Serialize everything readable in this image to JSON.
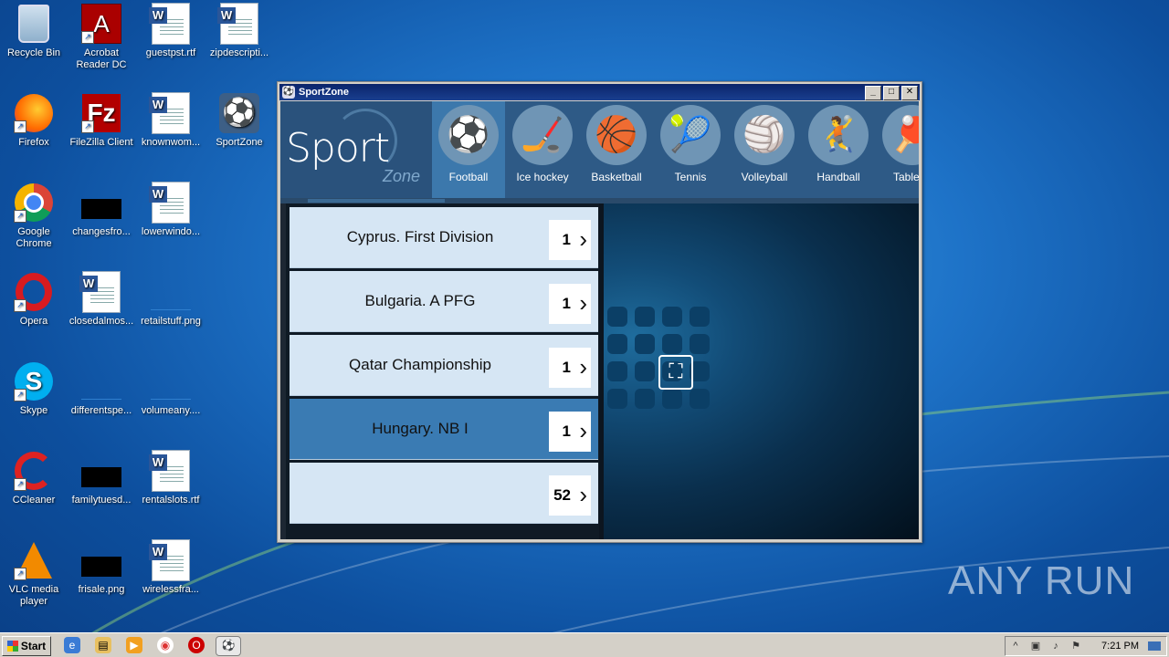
{
  "desktop": {
    "icons": [
      {
        "label": "Recycle Bin",
        "icon": "recycle-bin-icon"
      },
      {
        "label": "Acrobat Reader DC",
        "icon": "acrobat-icon"
      },
      {
        "label": "guestpst.rtf",
        "icon": "word-doc-icon"
      },
      {
        "label": "zipdescripti...",
        "icon": "word-doc-icon"
      },
      {
        "label": "Firefox",
        "icon": "firefox-icon"
      },
      {
        "label": "FileZilla Client",
        "icon": "filezilla-icon"
      },
      {
        "label": "knownwom...",
        "icon": "word-doc-icon"
      },
      {
        "label": "SportZone",
        "icon": "sportzone-icon"
      },
      {
        "label": "Google Chrome",
        "icon": "chrome-icon"
      },
      {
        "label": "changesfro...",
        "icon": "image-file-icon"
      },
      {
        "label": "lowerwindo...",
        "icon": "word-doc-icon"
      },
      {
        "label": "Opera",
        "icon": "opera-icon"
      },
      {
        "label": "closedalmos...",
        "icon": "word-doc-icon"
      },
      {
        "label": "retailstuff.png",
        "icon": "image-file-icon"
      },
      {
        "label": "Skype",
        "icon": "skype-icon"
      },
      {
        "label": "differentspe...",
        "icon": "image-file-icon"
      },
      {
        "label": "volumeany....",
        "icon": "image-file-icon"
      },
      {
        "label": "CCleaner",
        "icon": "ccleaner-icon"
      },
      {
        "label": "familytuesd...",
        "icon": "image-file-icon"
      },
      {
        "label": "rentalslots.rtf",
        "icon": "word-doc-icon"
      },
      {
        "label": "VLC media player",
        "icon": "vlc-icon"
      },
      {
        "label": "frisale.png",
        "icon": "image-file-icon"
      },
      {
        "label": "wirelessfra...",
        "icon": "word-doc-icon"
      }
    ]
  },
  "window": {
    "title": "SportZone",
    "logo": {
      "sport": "Sport",
      "zone": "Zone"
    },
    "sports": [
      {
        "label": "Football",
        "glyph": "⚽",
        "active": true
      },
      {
        "label": "Ice hockey",
        "glyph": "🏒",
        "active": false
      },
      {
        "label": "Basketball",
        "glyph": "🏀",
        "active": false
      },
      {
        "label": "Tennis",
        "glyph": "🎾",
        "active": false
      },
      {
        "label": "Volleyball",
        "glyph": "🏐",
        "active": false
      },
      {
        "label": "Handball",
        "glyph": "🤾",
        "active": false
      },
      {
        "label": "Table te",
        "glyph": "🏓",
        "active": false
      }
    ],
    "leagues": [
      {
        "name": "Cyprus. First Division",
        "count": "1",
        "selected": false
      },
      {
        "name": "Bulgaria. A PFG",
        "count": "1",
        "selected": false
      },
      {
        "name": "Qatar Championship",
        "count": "1",
        "selected": false
      },
      {
        "name": "Hungary. NB I",
        "count": "1",
        "selected": true
      },
      {
        "name": "",
        "count": "52",
        "selected": false
      }
    ]
  },
  "taskbar": {
    "start_label": "Start",
    "clock": "7:21 PM"
  },
  "watermark": "ANY RUN"
}
